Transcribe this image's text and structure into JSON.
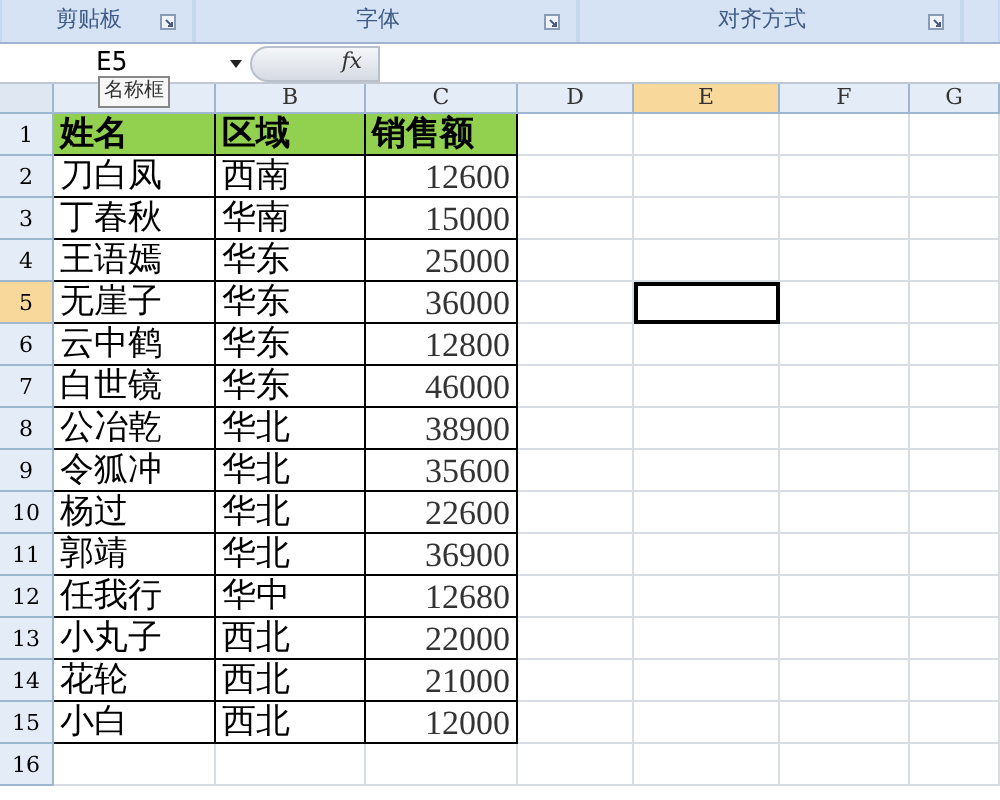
{
  "ribbon_groups": [
    {
      "label": "剪贴板"
    },
    {
      "label": "字体"
    },
    {
      "label": "对齐方式"
    }
  ],
  "formula_bar": {
    "name_box": "E5",
    "tooltip": "名称框",
    "fx": "fx"
  },
  "columns": [
    {
      "selected": false
    },
    {
      "label": "B",
      "selected": false
    },
    {
      "label": "C",
      "selected": false
    },
    {
      "label": "D",
      "selected": false
    },
    {
      "label": "E",
      "selected": true
    },
    {
      "label": "F",
      "selected": false
    },
    {
      "label": "G",
      "selected": false
    }
  ],
  "rows": [
    {
      "number": "1",
      "selected": false,
      "cells": [
        "姓名",
        "区域",
        "销售额"
      ]
    },
    {
      "number": "2",
      "selected": false,
      "cells": [
        "刀白凤",
        "西南",
        "12600"
      ]
    },
    {
      "number": "3",
      "selected": false,
      "cells": [
        "丁春秋",
        "华南",
        "15000"
      ]
    },
    {
      "number": "4",
      "selected": false,
      "cells": [
        "王语嫣",
        "华东",
        "25000"
      ]
    },
    {
      "number": "5",
      "selected": true,
      "cells": [
        "无崖子",
        "华东",
        "36000"
      ]
    },
    {
      "number": "6",
      "selected": false,
      "cells": [
        "云中鹤",
        "华东",
        "12800"
      ]
    },
    {
      "number": "7",
      "selected": false,
      "cells": [
        "白世镜",
        "华东",
        "46000"
      ]
    },
    {
      "number": "8",
      "selected": false,
      "cells": [
        "公冶乾",
        "华北",
        "38900"
      ]
    },
    {
      "number": "9",
      "selected": false,
      "cells": [
        "令狐冲",
        "华北",
        "35600"
      ]
    },
    {
      "number": "10",
      "selected": false,
      "cells": [
        "杨过",
        "华北",
        "22600"
      ]
    },
    {
      "number": "11",
      "selected": false,
      "cells": [
        "郭靖",
        "华北",
        "36900"
      ]
    },
    {
      "number": "12",
      "selected": false,
      "cells": [
        "任我行",
        "华中",
        "12680"
      ]
    },
    {
      "number": "13",
      "selected": false,
      "cells": [
        "小丸子",
        "西北",
        "22000"
      ]
    },
    {
      "number": "14",
      "selected": false,
      "cells": [
        "花轮",
        "西北",
        "21000"
      ]
    },
    {
      "number": "15",
      "selected": false,
      "cells": [
        "小白",
        "西北",
        "12000"
      ]
    },
    {
      "number": "16",
      "selected": false,
      "cells": []
    }
  ]
}
